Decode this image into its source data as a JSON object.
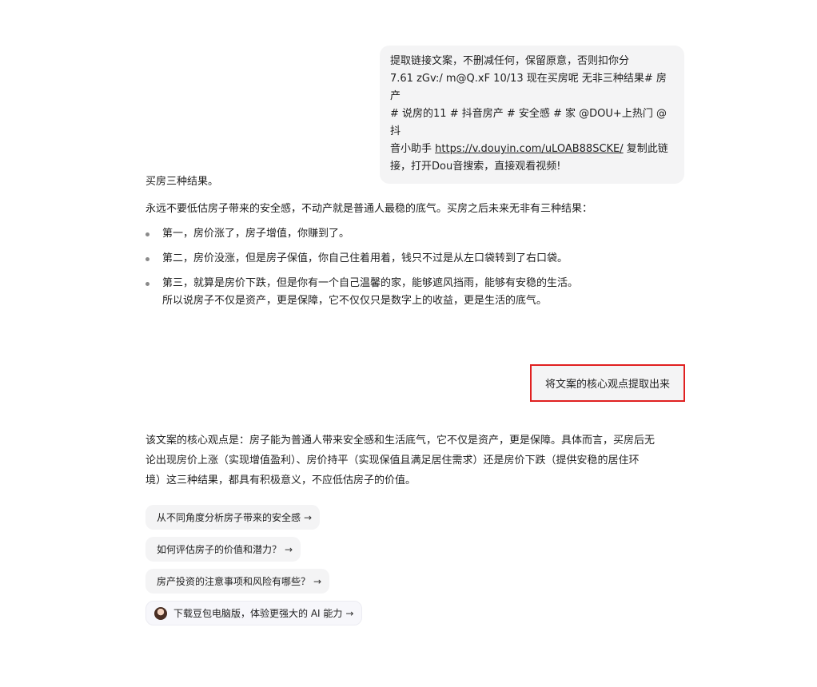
{
  "user_message_1": {
    "line1": "提取链接文案，不删减任何，保留原意，否则扣你分",
    "line2": "7.61 zGv:/ m@Q.xF 10/13 现在买房呢 无非三种结果# 房产",
    "line3": "# 说房的11 # 抖音房产 # 安全感 # 家 @DOU+上热门 @抖",
    "line4_prefix": "音小助手 ",
    "link": "https://v.douyin.com/uLOAB88SCKE/",
    "line4_suffix": " 复制此链",
    "line5": "接，打开Dou音搜索，直接观看视频!"
  },
  "assistant_reply_1": {
    "title": "买房三种结果。",
    "intro": "永远不要低估房子带来的安全感，不动产就是普通人最稳的底气。买房之后未来无非有三种结果：",
    "bullets": [
      "第一，房价涨了，房子增值，你赚到了。",
      "第二，房价没涨，但是房子保值，你自己住着用着，钱只不过是从左口袋转到了右口袋。",
      "第三，就算是房价下跌，但是你有一个自己温馨的家，能够遮风挡雨，能够有安稳的生活。"
    ],
    "bullet3_continuation": "所以说房子不仅是资产，更是保障，它不仅仅只是数字上的收益，更是生活的底气。"
  },
  "user_message_2": "将文案的核心观点提取出来",
  "assistant_reply_2": {
    "line1": "该文案的核心观点是：房子能为普通人带来安全感和生活底气，它不仅是资产，更是保障。具体而言，买房后无",
    "line2": "论出现房价上涨（实现增值盈利）、房价持平（实现保值且满足居住需求）还是房价下跌（提供安稳的居住环",
    "line3": "境）这三种结果，都具有积极意义，不应低估房子的价值。"
  },
  "suggestions": [
    "从不同角度分析房子带来的安全感",
    "如何评估房子的价值和潜力？",
    "房产投资的注意事项和风险有哪些？"
  ],
  "download_chip": "下载豆包电脑版，体验更强大的 AI 能力",
  "arrow": "→",
  "colors": {
    "highlight_border": "#e02020",
    "bubble_bg": "#f4f4f5"
  }
}
